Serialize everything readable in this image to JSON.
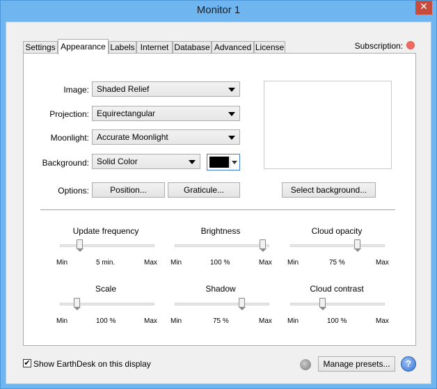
{
  "window": {
    "title": "Monitor 1",
    "close_glyph": "✕"
  },
  "tabs": [
    {
      "label": "Settings"
    },
    {
      "label": "Appearance"
    },
    {
      "label": "Labels"
    },
    {
      "label": "Internet"
    },
    {
      "label": "Database"
    },
    {
      "label": "Advanced"
    },
    {
      "label": "License"
    }
  ],
  "active_tab": "Appearance",
  "subscription": {
    "label": "Subscription:",
    "status_color": "#f06a60"
  },
  "appearance": {
    "image": {
      "label": "Image:",
      "value": "Shaded Relief"
    },
    "projection": {
      "label": "Projection:",
      "value": "Equirectangular"
    },
    "moonlight": {
      "label": "Moonlight:",
      "value": "Accurate Moonlight"
    },
    "background": {
      "label": "Background:",
      "value": "Solid Color",
      "color": "#000000"
    },
    "options": {
      "label": "Options:",
      "position_button": "Position...",
      "graticule_button": "Graticule...",
      "select_background_button": "Select background..."
    }
  },
  "sliders": [
    {
      "title": "Update frequency",
      "min": "Min",
      "max": "Max",
      "value": "5 min.",
      "level": 0.18
    },
    {
      "title": "Brightness",
      "min": "Min",
      "max": "Max",
      "value": "100 %",
      "level": 0.97
    },
    {
      "title": "Cloud opacity",
      "min": "Min",
      "max": "Max",
      "value": "75 %",
      "level": 0.73
    },
    {
      "title": "Scale",
      "min": "Min",
      "max": "Max",
      "value": "100 %",
      "level": 0.15
    },
    {
      "title": "Shadow",
      "min": "Min",
      "max": "Max",
      "value": "75 %",
      "level": 0.73
    },
    {
      "title": "Cloud contrast",
      "min": "Min",
      "max": "Max",
      "value": "100 %",
      "level": 0.33
    }
  ],
  "footer": {
    "show_checkbox_checked": true,
    "check_glyph": "✔",
    "show_label": "Show EarthDesk on this display",
    "manage_presets_button": "Manage presets...",
    "help_glyph": "?"
  }
}
